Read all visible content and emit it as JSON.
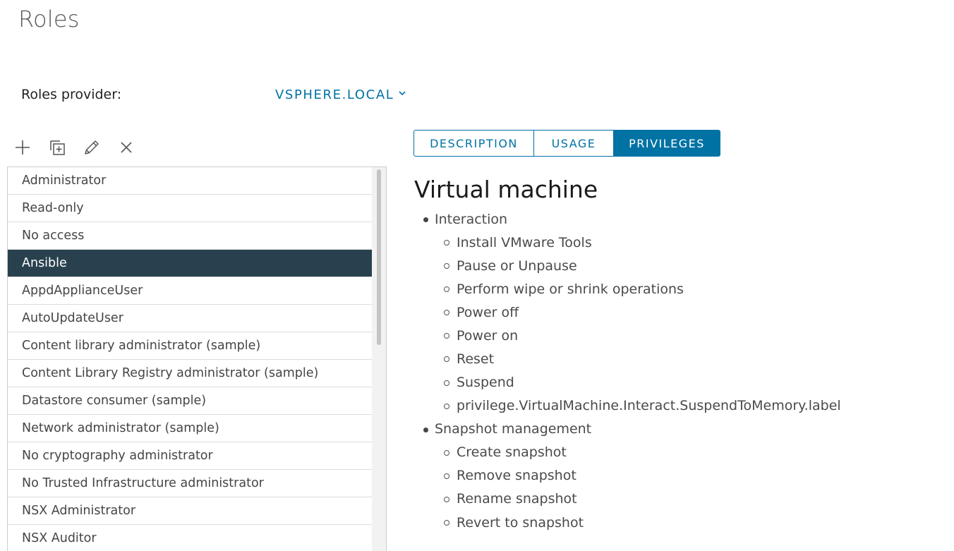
{
  "page": {
    "title": "Roles"
  },
  "provider": {
    "label": "Roles provider:",
    "value": "VSPHERE.LOCAL"
  },
  "toolbar": {
    "icons": [
      "plus-icon",
      "clone-icon",
      "pencil-icon",
      "close-icon"
    ]
  },
  "roles": {
    "selected": "Ansible",
    "items": [
      "Administrator",
      "Read-only",
      "No access",
      "Ansible",
      "AppdApplianceUser",
      "AutoUpdateUser",
      "Content library administrator (sample)",
      "Content Library Registry administrator (sample)",
      "Datastore consumer (sample)",
      "Network administrator (sample)",
      "No cryptography administrator",
      "No Trusted Infrastructure administrator",
      "NSX Administrator",
      "NSX Auditor"
    ]
  },
  "tabs": {
    "items": [
      {
        "label": "DESCRIPTION",
        "active": false
      },
      {
        "label": "USAGE",
        "active": false
      },
      {
        "label": "PRIVILEGES",
        "active": true
      }
    ]
  },
  "privileges": {
    "title": "Virtual machine",
    "groups": [
      {
        "label": "Interaction",
        "items": [
          "Install VMware Tools",
          "Pause or Unpause",
          "Perform wipe or shrink operations",
          "Power off",
          "Power on",
          "Reset",
          "Suspend",
          "privilege.VirtualMachine.Interact.SuspendToMemory.label"
        ]
      },
      {
        "label": "Snapshot management",
        "items": [
          "Create snapshot",
          "Remove snapshot",
          "Rename snapshot",
          "Revert to snapshot"
        ]
      }
    ]
  },
  "colors": {
    "accent": "#0072a3",
    "selected_row": "#29414e"
  }
}
